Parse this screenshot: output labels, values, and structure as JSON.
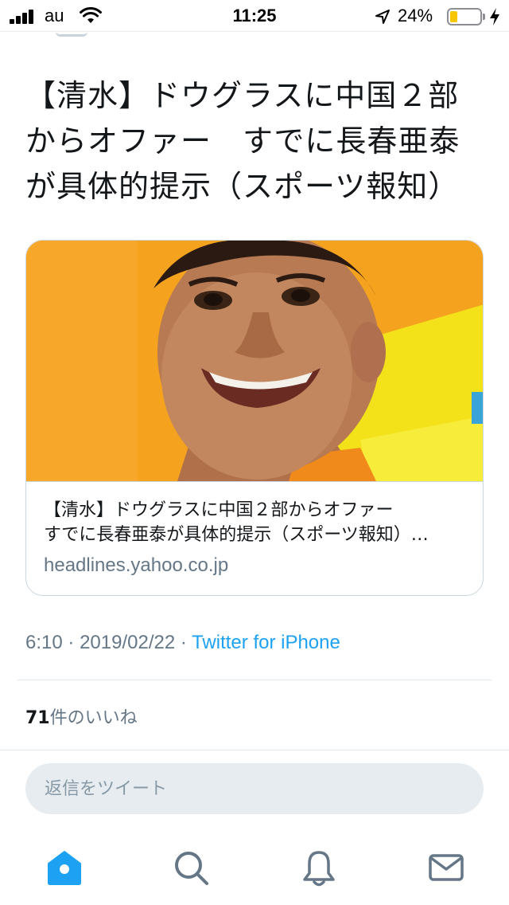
{
  "status_bar": {
    "carrier": "au",
    "time": "11:25",
    "battery_percent": "24%",
    "battery_level": 0.24,
    "battery_color": "#f7c600"
  },
  "tweet": {
    "text_lines": [
      "【清水】ドウグラスに中国２部",
      "からオファー　すでに長春亜泰",
      "が具体的提示（スポーツ報知）"
    ],
    "card": {
      "image_icon": "photo-of-person",
      "title_lines": [
        "【清水】ドウグラスに中国２部からオファー",
        "すでに長春亜泰が具体的提示（スポーツ報知）…"
      ],
      "domain": "headlines.yahoo.co.jp"
    },
    "meta": {
      "time": "6:10",
      "separator": "·",
      "date": "2019/02/22",
      "source": "Twitter for iPhone"
    },
    "likes": {
      "count": "71",
      "label": "件のいいね"
    }
  },
  "reply": {
    "placeholder": "返信をツイート"
  },
  "tab_bar": {
    "active_color": "#1da1f2",
    "inactive_color": "#657786",
    "tabs": [
      {
        "name": "home",
        "icon": "home-icon"
      },
      {
        "name": "search",
        "icon": "search-icon"
      },
      {
        "name": "notifications",
        "icon": "bell-icon"
      },
      {
        "name": "messages",
        "icon": "mail-icon"
      }
    ]
  }
}
